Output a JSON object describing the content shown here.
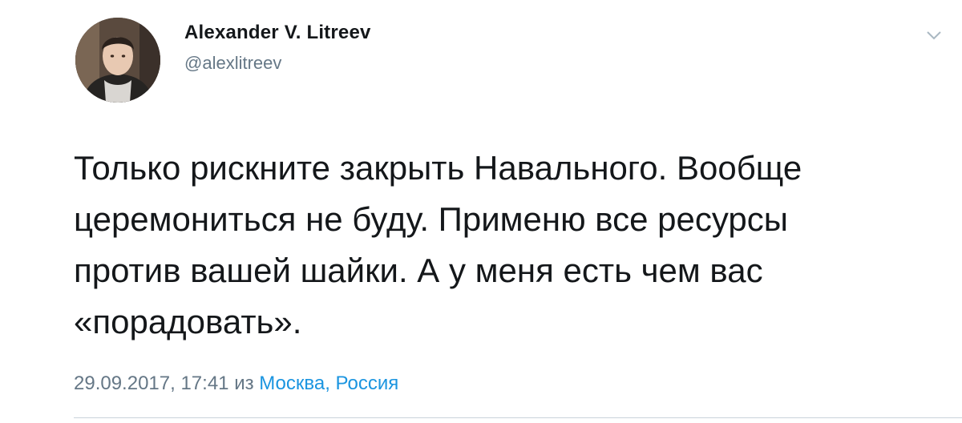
{
  "tweet": {
    "author": {
      "name": "Alexander V. Litreev",
      "handle": "@alexlitreev"
    },
    "text_lines": [
      "Только рискните закрыть Навального. Вообще",
      "церемониться не буду. Применю все ресурсы",
      "против вашей шайки. А у меня есть чем вас",
      "«порадовать»."
    ],
    "timestamp": "29.09.2017, 17:41",
    "from_word": "из",
    "location": "Москва, Россия",
    "icons": {
      "menu": "chevron-down-icon",
      "avatar": "profile-photo"
    },
    "colors": {
      "text": "#14171a",
      "secondary": "#657786",
      "link": "#1b95e0"
    }
  }
}
